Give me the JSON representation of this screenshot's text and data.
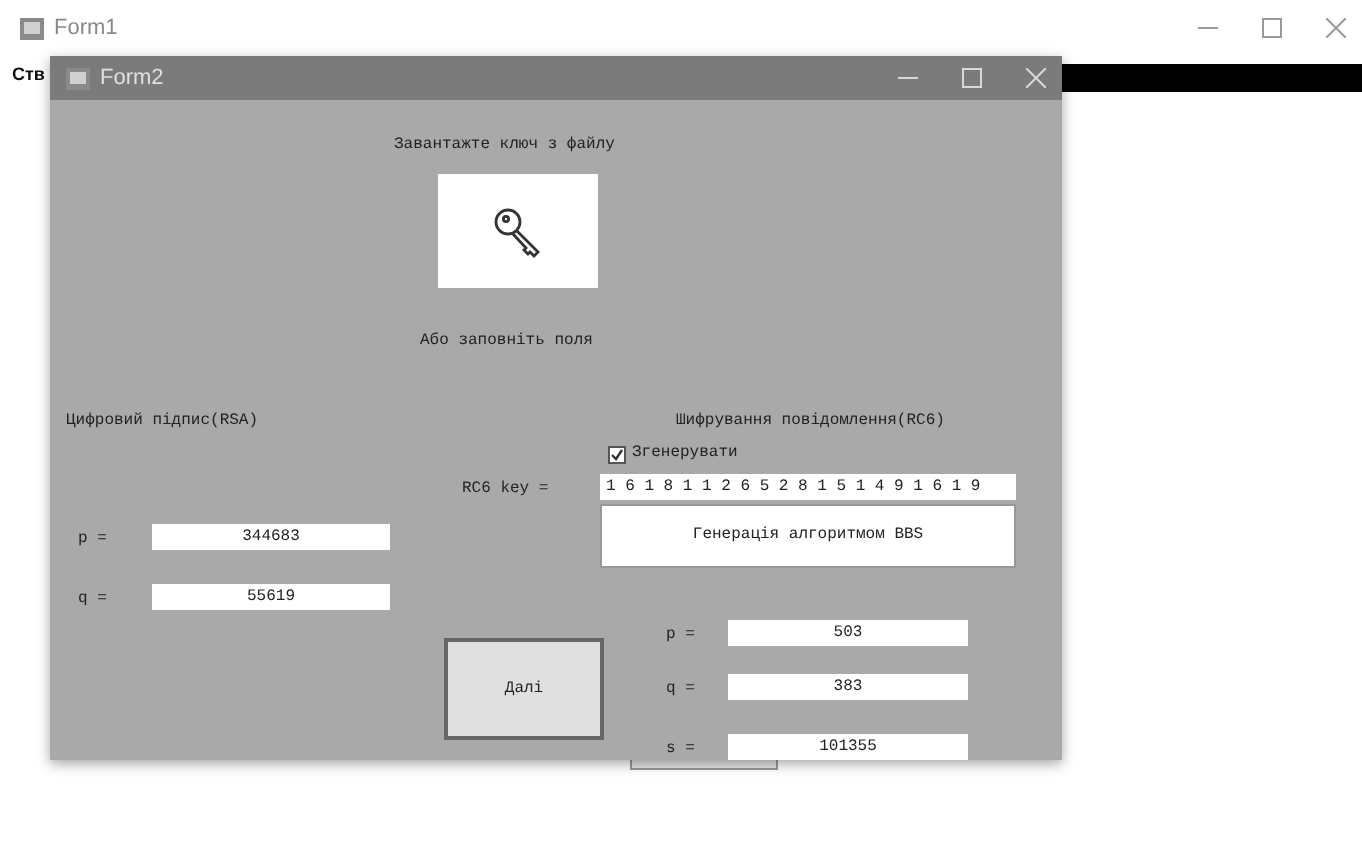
{
  "form1": {
    "title": "Form1",
    "label": "Ств"
  },
  "form2": {
    "title": "Form2",
    "load_label": "Завантажте ключ з файлу",
    "or_label": "Або заповніть поля",
    "rsa": {
      "title": "Цифровий підпис(RSA)",
      "fields": [
        {
          "label": "p =",
          "value": "344683"
        },
        {
          "label": "q =",
          "value": "55619"
        }
      ]
    },
    "rc6": {
      "title": "Шифрування повідомлення(RC6)",
      "generate": {
        "label": "Згенерувати",
        "checked": true
      },
      "key_label": "RC6 key =",
      "key_value": "1 6 1 8 1 1 2 6 5 2 8 1 5 1 4 9 1 6 1 9",
      "bbs_button": "Генерація алгоритмом BBS",
      "fields": [
        {
          "label": "p =",
          "value": "503"
        },
        {
          "label": "q =",
          "value": "383"
        },
        {
          "label": "s =",
          "value": "101355"
        }
      ]
    },
    "next_button": "Далі"
  }
}
